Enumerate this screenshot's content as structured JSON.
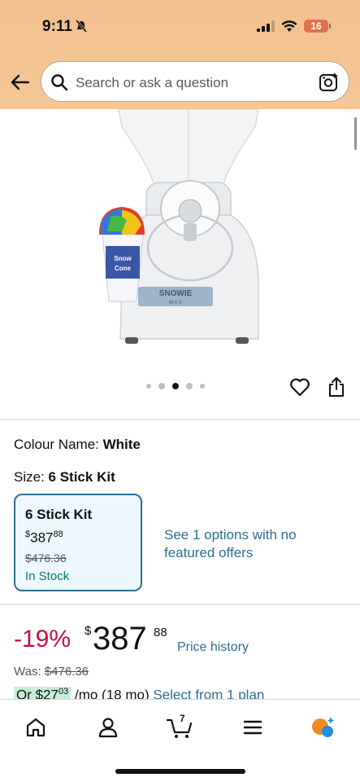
{
  "status_bar": {
    "time": "9:11",
    "battery": "16"
  },
  "search": {
    "placeholder": "Search or ask a question"
  },
  "gallery": {
    "dot_count": 5,
    "active_index": 2
  },
  "variant": {
    "colour_label": "Colour Name:",
    "colour_value": "White",
    "size_label": "Size:",
    "size_value": "6 Stick Kit"
  },
  "swatch": {
    "title": "6 Stick Kit",
    "currency": "$",
    "price_whole": "387",
    "price_fraction": "88",
    "was_price": "$476.36",
    "stock": "In Stock"
  },
  "other_options": "See 1 options with no featured offers",
  "price": {
    "discount": "-19%",
    "currency": "$",
    "whole": "387",
    "fraction": "88",
    "history_link": "Price history",
    "was_label": "Was:",
    "was_value": "$476.36"
  },
  "plan": {
    "prefix": "Or $27",
    "prefix_fraction": "03",
    "term": "/mo (18 mo)",
    "link": "Select from 1 plan"
  },
  "nav": {
    "cart_count": "7"
  },
  "colors": {
    "header": "#f1c08e",
    "link": "#2b6f93",
    "discount": "#cc0c39",
    "stock": "#067d62"
  }
}
